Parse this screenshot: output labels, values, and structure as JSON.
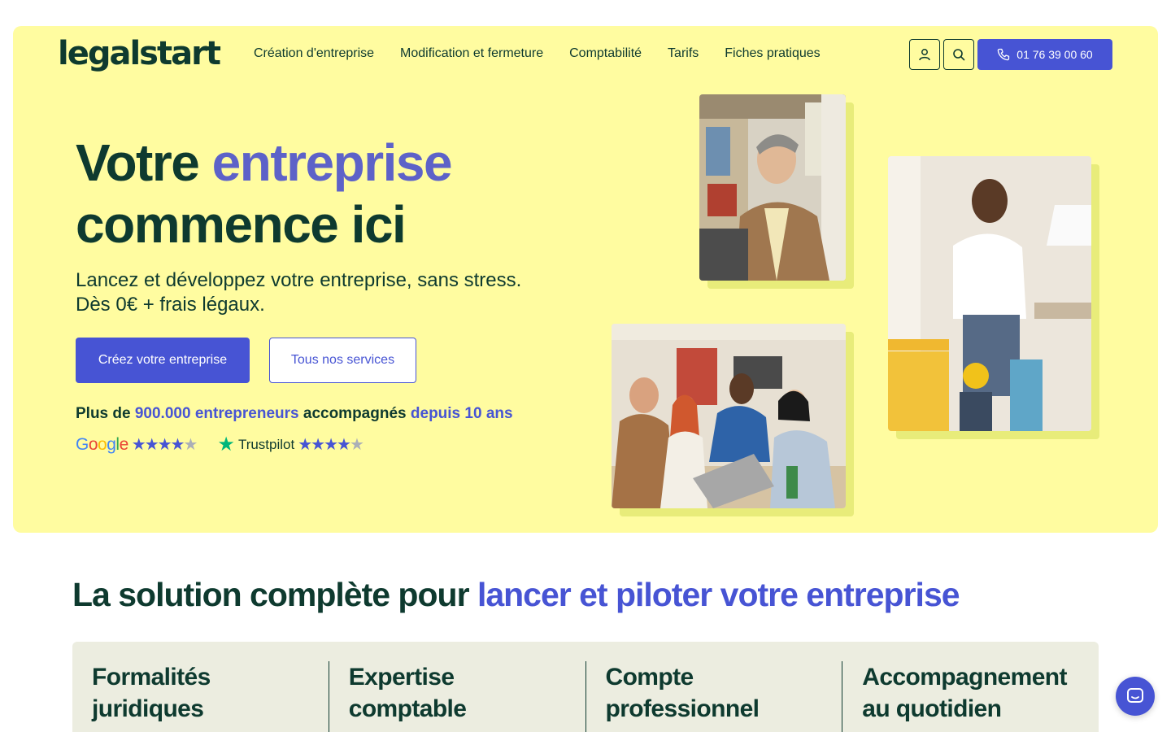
{
  "header": {
    "logo": "legalstart",
    "nav": [
      "Création d'entreprise",
      "Modification et fermeture",
      "Comptabilité",
      "Tarifs",
      "Fiches pratiques"
    ],
    "phone": "01 76 39 00 60"
  },
  "hero": {
    "title_part1": "Votre",
    "title_accent": "entreprise",
    "title_part2": "commence ici",
    "subtitle_line1": "Lancez et développez votre entreprise, sans stress.",
    "subtitle_line2": "Dès 0€ + frais légaux.",
    "cta_primary": "Créez votre entreprise",
    "cta_secondary": "Tous nos services",
    "proof_1": "Plus de",
    "proof_2": "900.000 entrepreneurs",
    "proof_3": "accompagnés",
    "proof_4": "depuis 10 ans",
    "google_label": "Google",
    "trustpilot_label": "Trustpilot",
    "google_rating": 4.5,
    "trustpilot_rating": 4.5
  },
  "section": {
    "title_part1": "La solution complète pour",
    "title_accent": "lancer et piloter votre entreprise",
    "cards": [
      {
        "line1": "Formalités",
        "line2": "juridiques"
      },
      {
        "line1": "Expertise",
        "line2": "comptable"
      },
      {
        "line1": "Compte",
        "line2": "professionnel"
      },
      {
        "line1": "Accompagnement",
        "line2": "au quotidien"
      }
    ]
  },
  "colors": {
    "hero_bg": "#fffca0",
    "brand_dark": "#0e3a2f",
    "accent": "#4754d4",
    "card_bg": "#ecede0"
  },
  "icons": [
    "user-icon",
    "search-icon",
    "phone-icon",
    "chat-icon",
    "google-logo",
    "trustpilot-star-icon",
    "star-icon"
  ]
}
